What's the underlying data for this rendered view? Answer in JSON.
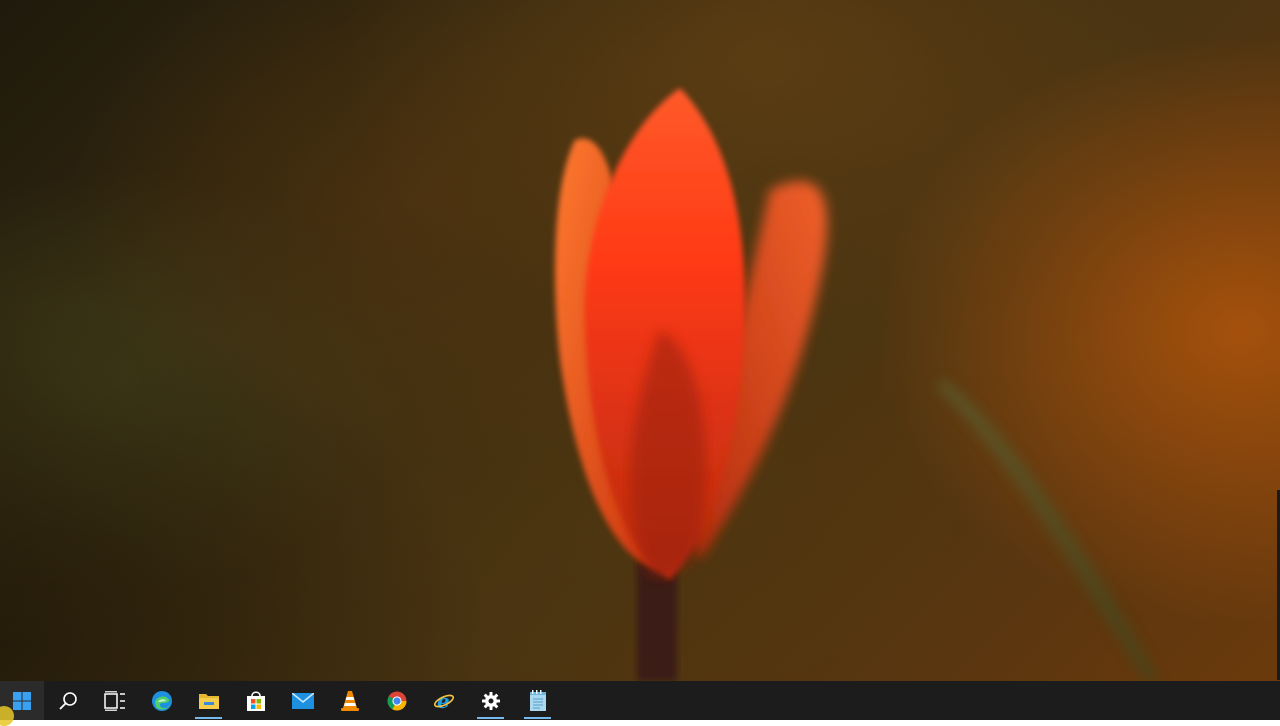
{
  "desktop": {
    "wallpaper": "red-tulip-bokeh",
    "colors": {
      "petal_light": "#ff4a1c",
      "petal_dark": "#d6330f",
      "stem": "#3a1a14",
      "taskbar": "#1c1c1c",
      "running_indicator": "#76b9ed"
    }
  },
  "taskbar": {
    "items": [
      {
        "name": "start",
        "icon": "windows-logo-icon",
        "color": "#3aa0f0"
      },
      {
        "name": "search",
        "icon": "search-icon",
        "color": "#ffffff"
      },
      {
        "name": "task-view",
        "icon": "task-view-icon",
        "color": "#ffffff"
      },
      {
        "name": "edge",
        "icon": "edge-icon",
        "color": "#1e90e0"
      },
      {
        "name": "file-explorer",
        "icon": "folder-icon",
        "color": "#f4c542",
        "running": true
      },
      {
        "name": "microsoft-store",
        "icon": "store-bag-icon",
        "color": "#ffffff"
      },
      {
        "name": "mail",
        "icon": "mail-icon",
        "color": "#1e90e0"
      },
      {
        "name": "vlc",
        "icon": "vlc-cone-icon",
        "color": "#f08a00"
      },
      {
        "name": "chrome",
        "icon": "chrome-icon",
        "color": "#db4437"
      },
      {
        "name": "internet-explorer",
        "icon": "ie-icon",
        "color": "#1ea0e8"
      },
      {
        "name": "settings",
        "icon": "gear-icon",
        "color": "#ffffff",
        "running": true
      },
      {
        "name": "notepad",
        "icon": "notepad-icon",
        "color": "#a9d8f0",
        "running": true
      }
    ]
  }
}
